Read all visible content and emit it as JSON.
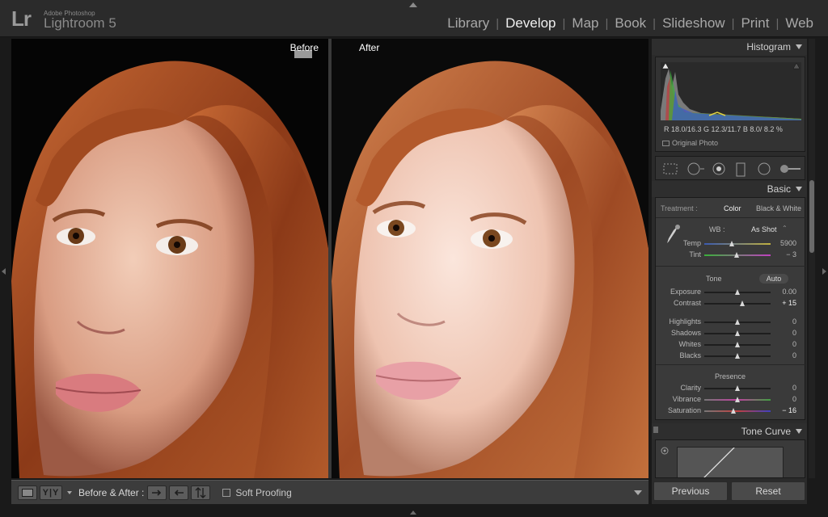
{
  "app": {
    "logo_mark": "Lr",
    "logo_subtitle": "Adobe Photoshop",
    "logo_name": "Lightroom 5"
  },
  "modules": [
    {
      "label": "Library",
      "active": false
    },
    {
      "label": "Develop",
      "active": true
    },
    {
      "label": "Map",
      "active": false
    },
    {
      "label": "Book",
      "active": false
    },
    {
      "label": "Slideshow",
      "active": false
    },
    {
      "label": "Print",
      "active": false
    },
    {
      "label": "Web",
      "active": false
    }
  ],
  "view": {
    "before_label": "Before",
    "after_label": "After"
  },
  "toolbar": {
    "yy_label": "Y|Y",
    "before_after_label": "Before & After :",
    "soft_proofing_label": "Soft Proofing",
    "soft_proofing_checked": false
  },
  "histogram": {
    "title": "Histogram",
    "readout": "R  18.0/16.3  G  12.3/11.7  B  8.0/  8.2  %",
    "original_photo_label": "Original Photo"
  },
  "basic": {
    "title": "Basic",
    "treatment_label": "Treatment :",
    "treatment_color": "Color",
    "treatment_bw": "Black & White",
    "wb_label": "WB :",
    "wb_value": "As Shot",
    "tone_label": "Tone",
    "auto_label": "Auto",
    "presence_label": "Presence",
    "sliders": {
      "temp": {
        "label": "Temp",
        "value": "5900",
        "level": 0.42
      },
      "tint": {
        "label": "Tint",
        "value": "− 3",
        "level": 0.49
      },
      "exposure": {
        "label": "Exposure",
        "value": "0.00",
        "level": 0.5
      },
      "contrast": {
        "label": "Contrast",
        "value": "+ 15",
        "level": 0.57
      },
      "highlights": {
        "label": "Highlights",
        "value": "0",
        "level": 0.5
      },
      "shadows": {
        "label": "Shadows",
        "value": "0",
        "level": 0.5
      },
      "whites": {
        "label": "Whites",
        "value": "0",
        "level": 0.5
      },
      "blacks": {
        "label": "Blacks",
        "value": "0",
        "level": 0.5
      },
      "clarity": {
        "label": "Clarity",
        "value": "0",
        "level": 0.5
      },
      "vibrance": {
        "label": "Vibrance",
        "value": "0",
        "level": 0.5
      },
      "saturation": {
        "label": "Saturation",
        "value": "− 16",
        "level": 0.44
      }
    }
  },
  "tone_curve": {
    "title": "Tone Curve"
  },
  "buttons": {
    "previous": "Previous",
    "reset": "Reset"
  },
  "colors": {
    "accent_text": "#f0f0f0",
    "panel_bg": "#3a3a3a",
    "skin": "#e8b7a0",
    "hair": "#b4552a"
  }
}
